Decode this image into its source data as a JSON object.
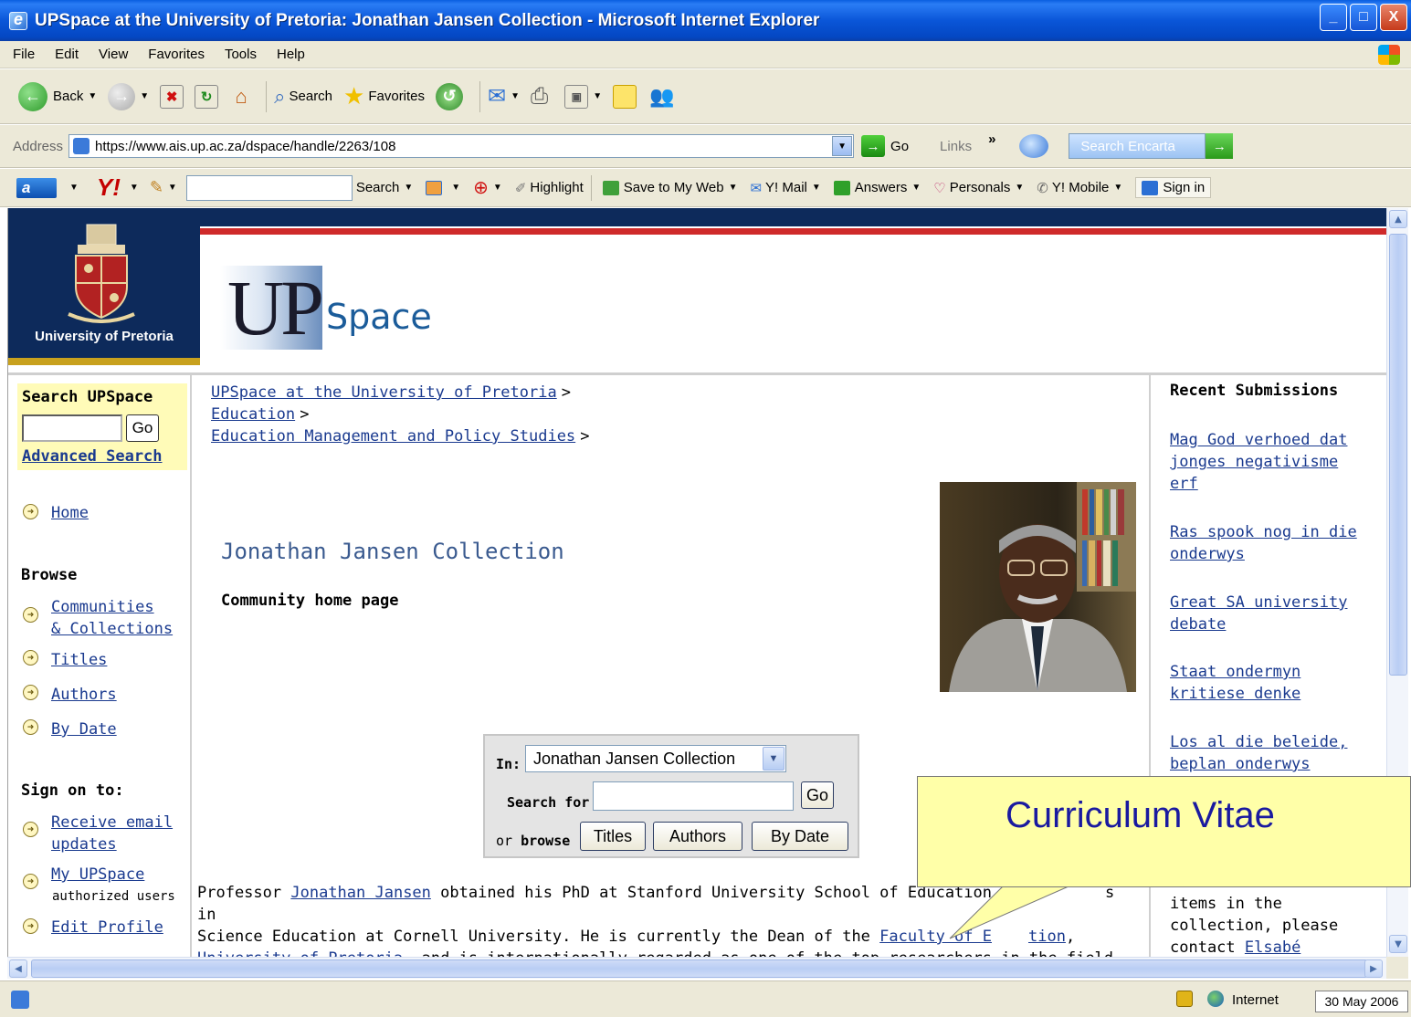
{
  "window": {
    "title": "UPSpace at the University of Pretoria: Jonathan Jansen Collection - Microsoft Internet Explorer",
    "minimize": "_",
    "maximize": "□",
    "close": "X"
  },
  "menu": [
    "File",
    "Edit",
    "View",
    "Favorites",
    "Tools",
    "Help"
  ],
  "toolbar": {
    "back": "Back",
    "search": "Search",
    "favorites": "Favorites"
  },
  "address": {
    "label": "Address",
    "url": "https://www.ais.up.ac.za/dspace/handle/2263/108",
    "go": "Go",
    "links": "Links",
    "chevron": "»",
    "encarta_placeholder": "Search Encarta"
  },
  "yahoo_bar": {
    "search": "Search",
    "highlight": "Highlight",
    "save_to_my_web": "Save to My Web",
    "mail": "Y! Mail",
    "answers": "Answers",
    "personals": "Personals",
    "mobile": "Y! Mobile",
    "sign_in": "Sign in"
  },
  "header": {
    "university": "University of Pretoria",
    "logo_up": "UP",
    "logo_space": "Space"
  },
  "left_nav": {
    "search_heading": "Search UPSpace",
    "go": "Go",
    "advanced_search": "Advanced Search",
    "home": "Home",
    "browse_heading": "Browse",
    "communities_1": "Communities",
    "communities_2": "& Collections",
    "titles": "Titles",
    "authors": "Authors",
    "by_date": "By Date",
    "sign_on_heading": "Sign on to:",
    "receive_email_1": "Receive email",
    "receive_email_2": "updates",
    "my_upspace": "My UPSpace",
    "authorized_users": "authorized users",
    "edit_profile": "Edit Profile"
  },
  "breadcrumbs": [
    "UPSpace at the University of Pretoria",
    "Education",
    "Education Management and Policy Studies"
  ],
  "breadcrumb_sep": ">",
  "main": {
    "title": "Jonathan Jansen Collection",
    "subtitle": "Community home page"
  },
  "search_box": {
    "in_label": "In:",
    "scope": "Jonathan Jansen Collection",
    "search_for": "Search for",
    "go": "Go",
    "or": "or",
    "browse": "browse",
    "titles": "Titles",
    "authors": "Authors",
    "by_date": "By Date"
  },
  "intro": {
    "p1": "Professor",
    "link_name": "Jonathan Jansen",
    "p2": " obtained his PhD at Stanford University School of Education",
    "p2b": "s in",
    "p3": "Science Education at Cornell University. He is currently the Dean of the ",
    "link_faculty": "Faculty of E",
    "link_faculty_tail": "tion",
    "p4": ",",
    "link_up": "University of Pretoria",
    "p5": ", and is internationally regarded as one of the top researchers in the field of"
  },
  "recent": {
    "heading": "Recent Submissions",
    "items": [
      [
        "Mag God verhoed dat",
        "jonges negativisme",
        "erf"
      ],
      [
        "Ras spook nog in die",
        "onderwys"
      ],
      [
        "Great SA university",
        "debate"
      ],
      [
        "Staat ondermyn",
        "kritiese denke"
      ],
      [
        "Los al die beleide,",
        "beplan onderwys"
      ]
    ],
    "tail_1": "items in the",
    "tail_2": "collection, please",
    "tail_3": "contact ",
    "contact_link": "Elsabé"
  },
  "callout": "Curriculum Vitae",
  "status": {
    "zone": "Internet",
    "date": "30 May 2006"
  },
  "colors": {
    "navy": "#0d2a5b",
    "red_rule": "#cf2a2a",
    "gold": "#c8a11e",
    "link": "#1a3a8f",
    "title_blue": "#3a5a8f",
    "search_panel": "#fffbb8",
    "callout_bg": "#ffffa8",
    "callout_text": "#1a1aa0"
  }
}
